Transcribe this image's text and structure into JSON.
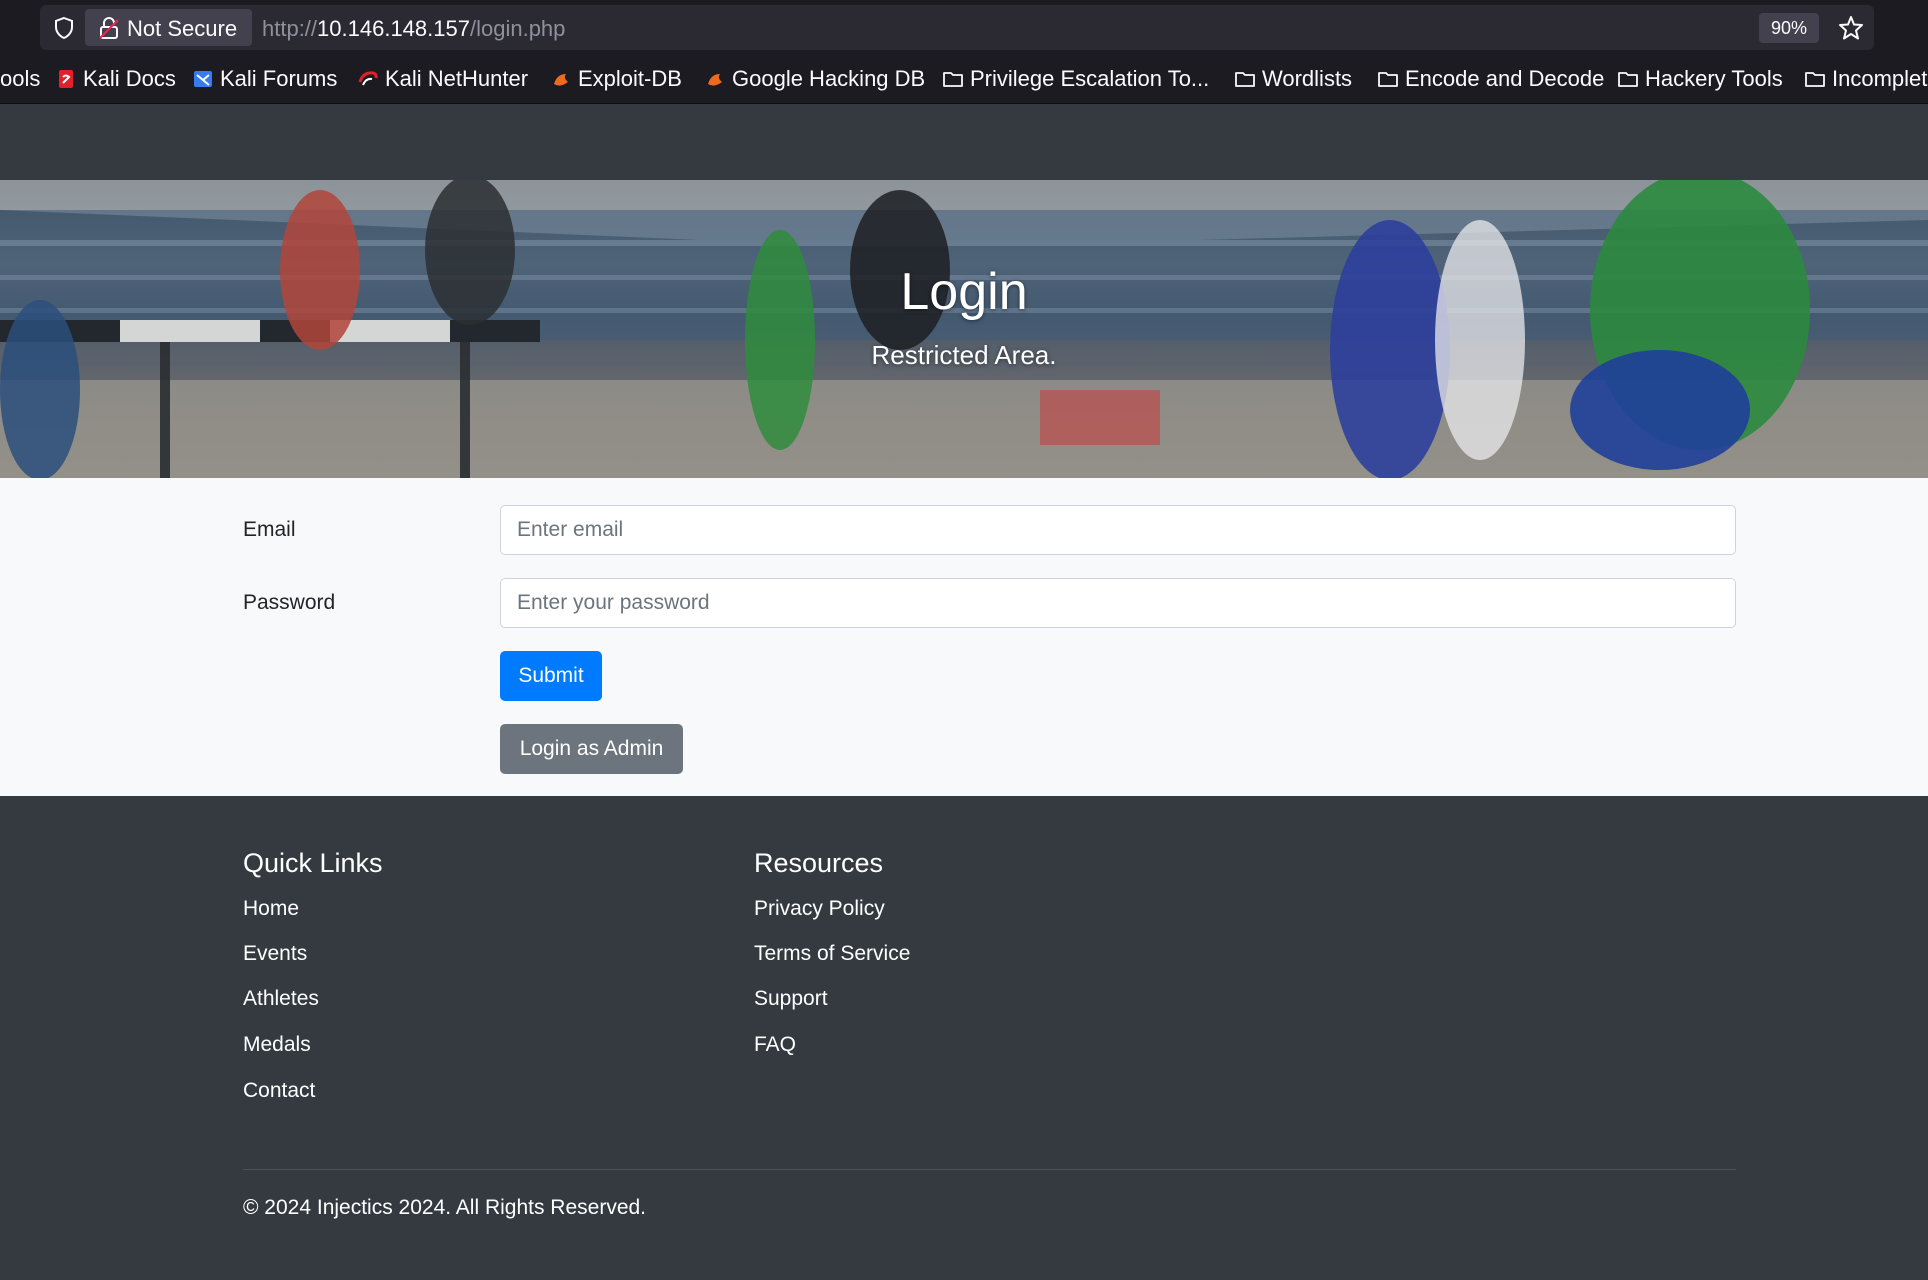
{
  "browser": {
    "security_label": "Not Secure",
    "url_prefix": "http://",
    "url_host": "10.146.148.157",
    "url_path": "/login.php",
    "zoom": "90%",
    "bookmarks": [
      {
        "label": "ools",
        "icon": "none"
      },
      {
        "label": "Kali Docs",
        "icon": "kali-docs-icon"
      },
      {
        "label": "Kali Forums",
        "icon": "kali-forums-icon"
      },
      {
        "label": "Kali NetHunter",
        "icon": "nethunter-icon"
      },
      {
        "label": "Exploit-DB",
        "icon": "exploit-db-icon"
      },
      {
        "label": "Google Hacking DB",
        "icon": "ghdb-icon"
      },
      {
        "label": "Privilege Escalation To...",
        "icon": "folder-icon"
      },
      {
        "label": "Wordlists",
        "icon": "folder-icon"
      },
      {
        "label": "Encode and Decode",
        "icon": "folder-icon"
      },
      {
        "label": "Hackery Tools",
        "icon": "folder-icon"
      },
      {
        "label": "Incomplet",
        "icon": "folder-icon"
      }
    ]
  },
  "hero": {
    "title": "Login",
    "subtitle": "Restricted Area."
  },
  "form": {
    "email_label": "Email",
    "email_placeholder": "Enter email",
    "email_value": "",
    "password_label": "Password",
    "password_placeholder": "Enter your password",
    "password_value": "",
    "submit_label": "Submit",
    "admin_label": "Login as Admin"
  },
  "footer": {
    "quick_links_title": "Quick Links",
    "quick_links": [
      "Home",
      "Events",
      "Athletes",
      "Medals",
      "Contact"
    ],
    "resources_title": "Resources",
    "resources": [
      "Privacy Policy",
      "Terms of Service",
      "Support",
      "FAQ"
    ],
    "copyright": "© 2024 Injectics 2024. All Rights Reserved."
  },
  "colors": {
    "navbar_bg": "#343a40",
    "primary": "#007bff",
    "secondary": "#6c757d",
    "form_bg": "#f8f9fa"
  }
}
